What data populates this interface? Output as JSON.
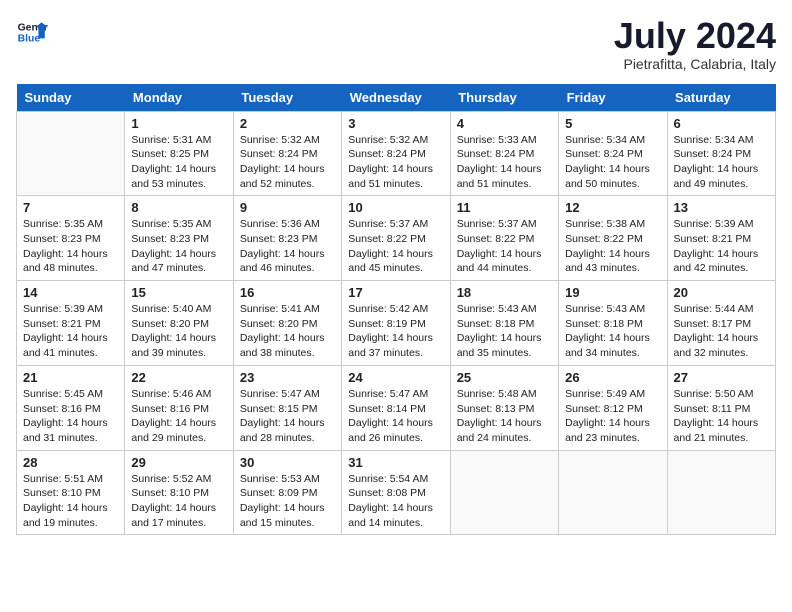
{
  "header": {
    "logo_line1": "General",
    "logo_line2": "Blue",
    "month_year": "July 2024",
    "location": "Pietrafitta, Calabria, Italy"
  },
  "weekdays": [
    "Sunday",
    "Monday",
    "Tuesday",
    "Wednesday",
    "Thursday",
    "Friday",
    "Saturday"
  ],
  "weeks": [
    [
      {
        "day": "",
        "info": ""
      },
      {
        "day": "1",
        "info": "Sunrise: 5:31 AM\nSunset: 8:25 PM\nDaylight: 14 hours\nand 53 minutes."
      },
      {
        "day": "2",
        "info": "Sunrise: 5:32 AM\nSunset: 8:24 PM\nDaylight: 14 hours\nand 52 minutes."
      },
      {
        "day": "3",
        "info": "Sunrise: 5:32 AM\nSunset: 8:24 PM\nDaylight: 14 hours\nand 51 minutes."
      },
      {
        "day": "4",
        "info": "Sunrise: 5:33 AM\nSunset: 8:24 PM\nDaylight: 14 hours\nand 51 minutes."
      },
      {
        "day": "5",
        "info": "Sunrise: 5:34 AM\nSunset: 8:24 PM\nDaylight: 14 hours\nand 50 minutes."
      },
      {
        "day": "6",
        "info": "Sunrise: 5:34 AM\nSunset: 8:24 PM\nDaylight: 14 hours\nand 49 minutes."
      }
    ],
    [
      {
        "day": "7",
        "info": "Sunrise: 5:35 AM\nSunset: 8:23 PM\nDaylight: 14 hours\nand 48 minutes."
      },
      {
        "day": "8",
        "info": "Sunrise: 5:35 AM\nSunset: 8:23 PM\nDaylight: 14 hours\nand 47 minutes."
      },
      {
        "day": "9",
        "info": "Sunrise: 5:36 AM\nSunset: 8:23 PM\nDaylight: 14 hours\nand 46 minutes."
      },
      {
        "day": "10",
        "info": "Sunrise: 5:37 AM\nSunset: 8:22 PM\nDaylight: 14 hours\nand 45 minutes."
      },
      {
        "day": "11",
        "info": "Sunrise: 5:37 AM\nSunset: 8:22 PM\nDaylight: 14 hours\nand 44 minutes."
      },
      {
        "day": "12",
        "info": "Sunrise: 5:38 AM\nSunset: 8:22 PM\nDaylight: 14 hours\nand 43 minutes."
      },
      {
        "day": "13",
        "info": "Sunrise: 5:39 AM\nSunset: 8:21 PM\nDaylight: 14 hours\nand 42 minutes."
      }
    ],
    [
      {
        "day": "14",
        "info": "Sunrise: 5:39 AM\nSunset: 8:21 PM\nDaylight: 14 hours\nand 41 minutes."
      },
      {
        "day": "15",
        "info": "Sunrise: 5:40 AM\nSunset: 8:20 PM\nDaylight: 14 hours\nand 39 minutes."
      },
      {
        "day": "16",
        "info": "Sunrise: 5:41 AM\nSunset: 8:20 PM\nDaylight: 14 hours\nand 38 minutes."
      },
      {
        "day": "17",
        "info": "Sunrise: 5:42 AM\nSunset: 8:19 PM\nDaylight: 14 hours\nand 37 minutes."
      },
      {
        "day": "18",
        "info": "Sunrise: 5:43 AM\nSunset: 8:18 PM\nDaylight: 14 hours\nand 35 minutes."
      },
      {
        "day": "19",
        "info": "Sunrise: 5:43 AM\nSunset: 8:18 PM\nDaylight: 14 hours\nand 34 minutes."
      },
      {
        "day": "20",
        "info": "Sunrise: 5:44 AM\nSunset: 8:17 PM\nDaylight: 14 hours\nand 32 minutes."
      }
    ],
    [
      {
        "day": "21",
        "info": "Sunrise: 5:45 AM\nSunset: 8:16 PM\nDaylight: 14 hours\nand 31 minutes."
      },
      {
        "day": "22",
        "info": "Sunrise: 5:46 AM\nSunset: 8:16 PM\nDaylight: 14 hours\nand 29 minutes."
      },
      {
        "day": "23",
        "info": "Sunrise: 5:47 AM\nSunset: 8:15 PM\nDaylight: 14 hours\nand 28 minutes."
      },
      {
        "day": "24",
        "info": "Sunrise: 5:47 AM\nSunset: 8:14 PM\nDaylight: 14 hours\nand 26 minutes."
      },
      {
        "day": "25",
        "info": "Sunrise: 5:48 AM\nSunset: 8:13 PM\nDaylight: 14 hours\nand 24 minutes."
      },
      {
        "day": "26",
        "info": "Sunrise: 5:49 AM\nSunset: 8:12 PM\nDaylight: 14 hours\nand 23 minutes."
      },
      {
        "day": "27",
        "info": "Sunrise: 5:50 AM\nSunset: 8:11 PM\nDaylight: 14 hours\nand 21 minutes."
      }
    ],
    [
      {
        "day": "28",
        "info": "Sunrise: 5:51 AM\nSunset: 8:10 PM\nDaylight: 14 hours\nand 19 minutes."
      },
      {
        "day": "29",
        "info": "Sunrise: 5:52 AM\nSunset: 8:10 PM\nDaylight: 14 hours\nand 17 minutes."
      },
      {
        "day": "30",
        "info": "Sunrise: 5:53 AM\nSunset: 8:09 PM\nDaylight: 14 hours\nand 15 minutes."
      },
      {
        "day": "31",
        "info": "Sunrise: 5:54 AM\nSunset: 8:08 PM\nDaylight: 14 hours\nand 14 minutes."
      },
      {
        "day": "",
        "info": ""
      },
      {
        "day": "",
        "info": ""
      },
      {
        "day": "",
        "info": ""
      }
    ]
  ]
}
